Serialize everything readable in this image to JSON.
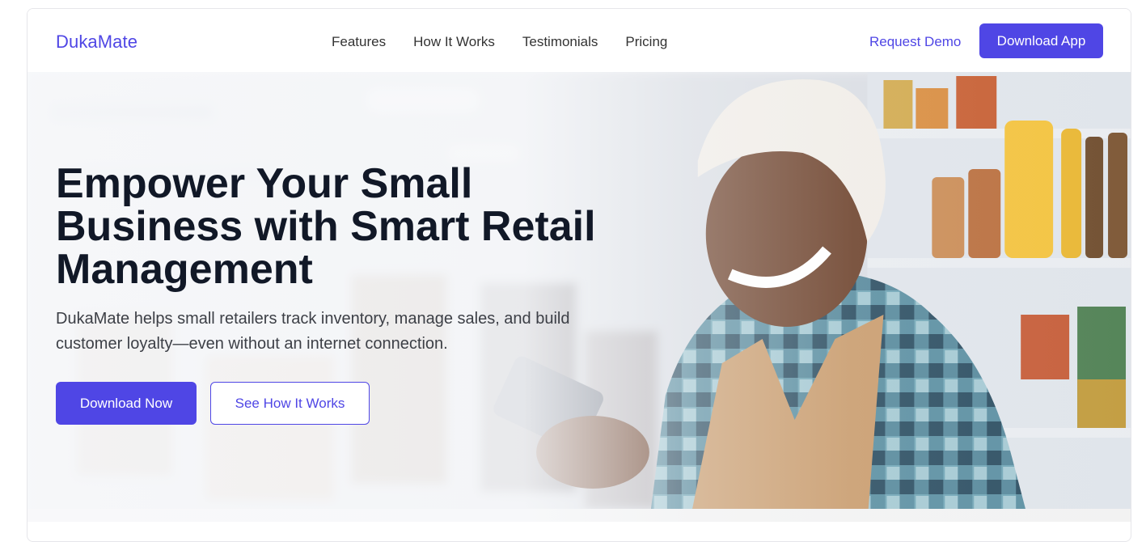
{
  "brand": {
    "name": "DukaMate",
    "accent": "#4f46e5"
  },
  "nav": {
    "links": [
      "Features",
      "How It Works",
      "Testimonials",
      "Pricing"
    ],
    "request_demo": "Request Demo",
    "download_app": "Download App"
  },
  "hero": {
    "title": "Empower Your Small Business with Smart Retail Management",
    "subtitle": "DukaMate helps small retailers track inventory, manage sales, and build customer loyalty—even without an internet connection.",
    "primary_cta": "Download Now",
    "secondary_cta": "See How It Works",
    "image_alt": "smiling shopkeeper holding phone in store"
  }
}
